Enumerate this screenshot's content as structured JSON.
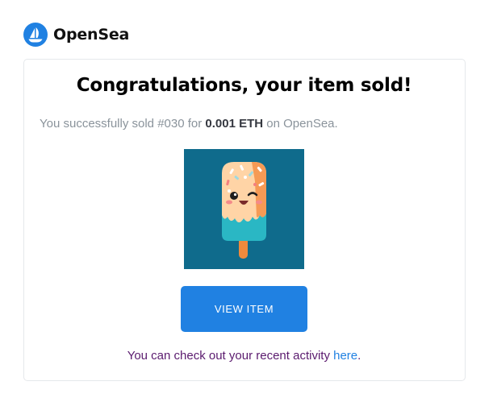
{
  "brand": {
    "name": "OpenSea",
    "color": "#2081e2"
  },
  "email": {
    "title": "Congratulations, your item sold!",
    "message_prefix": "You successfully sold #030 for ",
    "price": "0.001 ETH",
    "message_suffix": " on OpenSea.",
    "item_image": "popsicle-nft-image",
    "view_button_label": "VIEW ITEM",
    "activity_prefix": "You can check out your recent activity ",
    "activity_link_label": "here",
    "activity_suffix": "."
  }
}
